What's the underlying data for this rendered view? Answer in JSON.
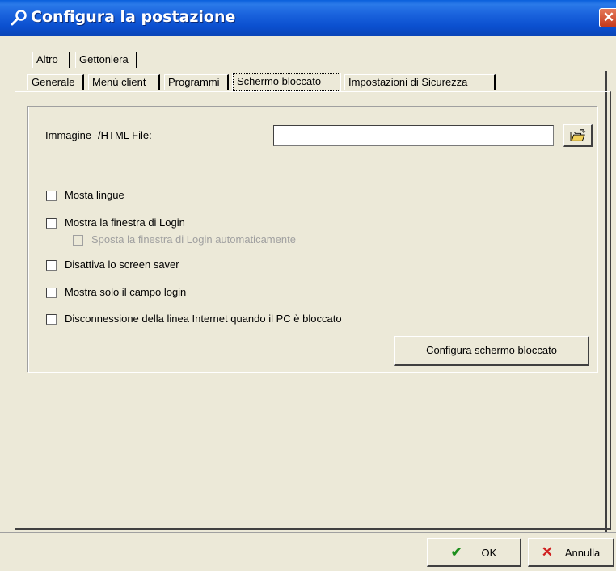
{
  "window": {
    "title": "Configura la postazione",
    "close_glyph": "✕"
  },
  "tabs_row1": [
    {
      "label": "Altro"
    },
    {
      "label": "Gettoniera"
    }
  ],
  "tabs_row2": [
    {
      "label": "Generale"
    },
    {
      "label": "Menù client"
    },
    {
      "label": "Programmi"
    },
    {
      "label": "Schermo bloccato",
      "active": true
    },
    {
      "label": "Impostazioni di Sicurezza"
    }
  ],
  "image_field": {
    "label": "Immagine -/HTML File:",
    "value": "",
    "browse_icon": "folder-open-icon"
  },
  "options": [
    {
      "label": "Mosta lingue",
      "checked": false
    },
    {
      "label": "Mostra la finestra di Login",
      "checked": false
    },
    {
      "label": "Sposta la finestra di Login automaticamente",
      "checked": false,
      "disabled": true
    },
    {
      "label": "Disattiva lo screen saver",
      "checked": false
    },
    {
      "label": "Mostra solo il campo login",
      "checked": false
    },
    {
      "label": "Disconnessione della linea Internet quando il PC è bloccato",
      "checked": false
    }
  ],
  "configure_button": "Configura schermo bloccato",
  "footer": {
    "ok_label": "OK",
    "ok_icon": "✔",
    "cancel_label": "Annulla",
    "cancel_icon": "✕"
  },
  "colors": {
    "title_bar": "#0a5fdc",
    "ok_green": "#1d8f1d",
    "cancel_red": "#d02020"
  }
}
